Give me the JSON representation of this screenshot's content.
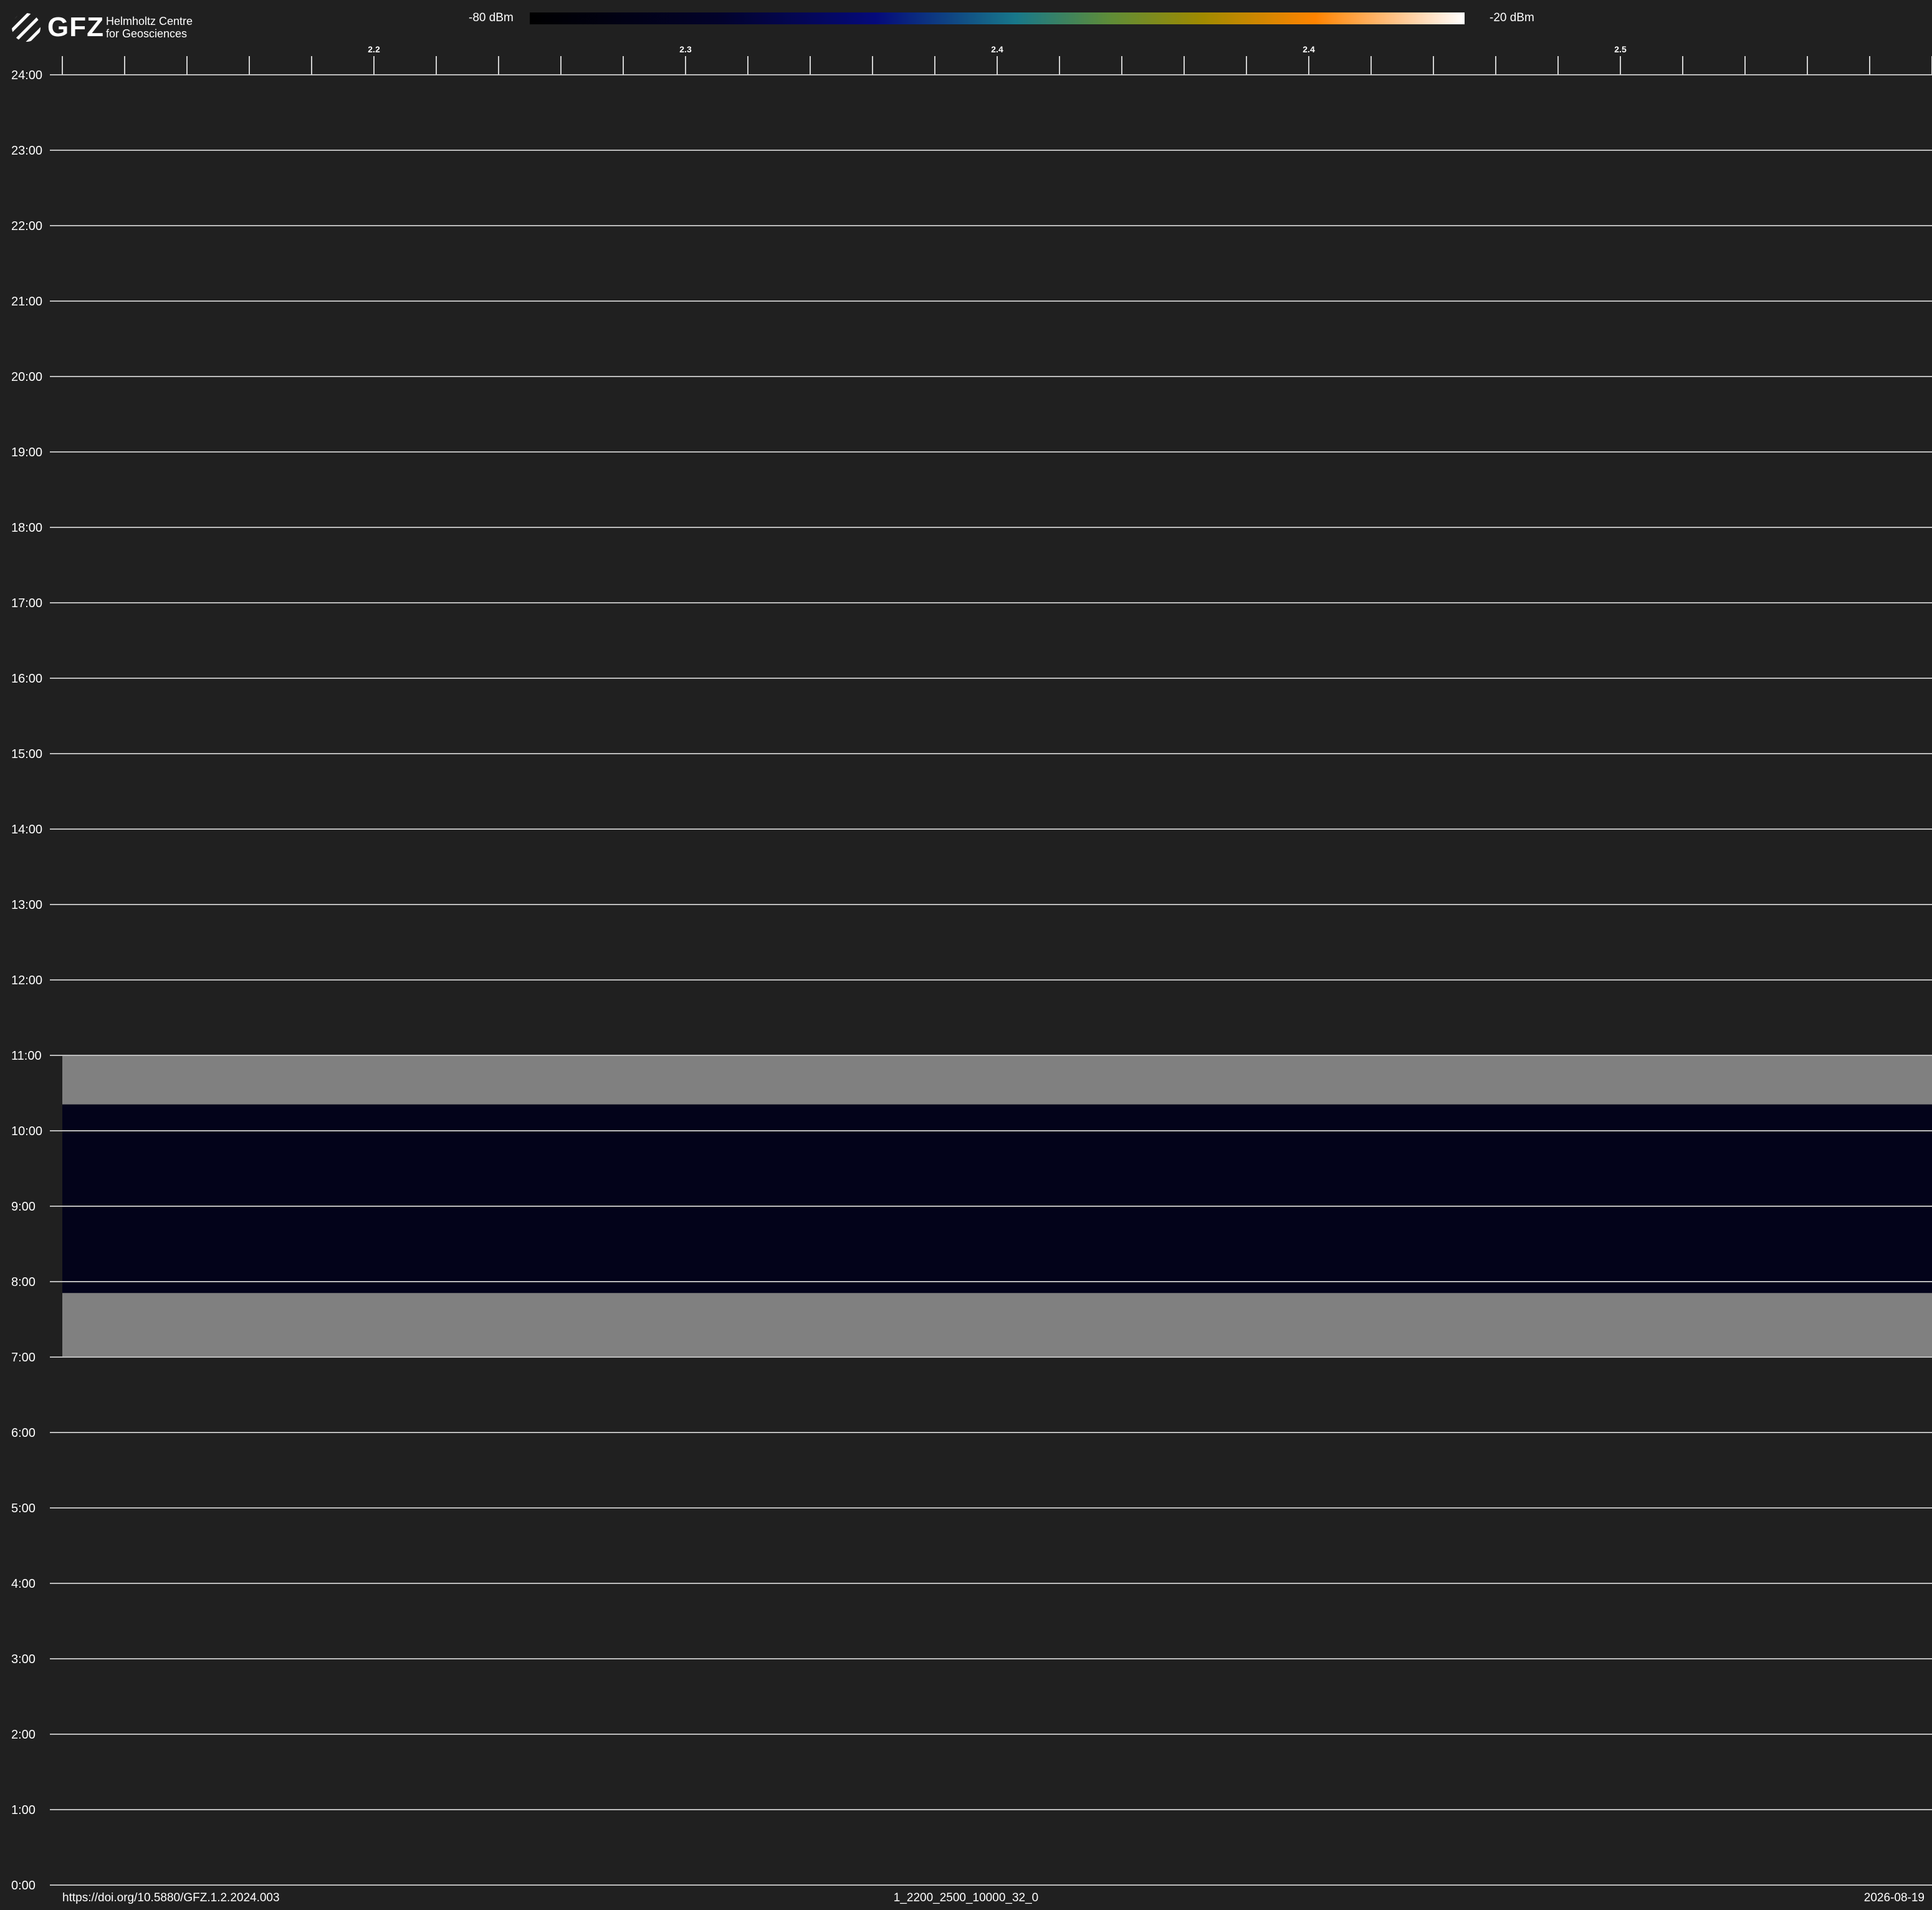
{
  "header": {
    "logo_word": "GFZ",
    "logo_line1": "Helmholtz Centre",
    "logo_line2": "for Geosciences"
  },
  "colorbar": {
    "min_label": "-80 dBm",
    "max_label": "-20 dBm",
    "min_value": -80,
    "max_value": -20,
    "colors": [
      "#000000",
      "#02022a",
      "#050a7a",
      "#18788a",
      "#5e8c38",
      "#a08a00",
      "#ff8300",
      "#ffc68e",
      "#ffffff"
    ]
  },
  "footer": {
    "doi": "https://doi.org/10.5880/GFZ.1.2.2024.003",
    "id": "1_2200_2500_10000_32_0",
    "date": "2026-08-19"
  },
  "chart_data": {
    "type": "heatmap",
    "y_ticks": [
      "0:00",
      "1:00",
      "2:00",
      "3:00",
      "4:00",
      "5:00",
      "6:00",
      "7:00",
      "8:00",
      "9:00",
      "10:00",
      "11:00",
      "12:00",
      "13:00",
      "14:00",
      "15:00",
      "16:00",
      "17:00",
      "18:00",
      "19:00",
      "20:00",
      "21:00",
      "22:00",
      "23:00",
      "24:00"
    ],
    "ylim": [
      0,
      24
    ],
    "x_tick_labels": [
      "2.2",
      "2.3",
      "2.4",
      "2.4",
      "2.5"
    ],
    "x_tick_label_every": 5,
    "x_minor_tick_count": 31,
    "grid": true,
    "bands": [
      {
        "kind": "no-data",
        "y_start": 7.0,
        "y_end": 7.85,
        "color": "#808080"
      },
      {
        "kind": "signal",
        "y_start": 7.85,
        "y_end": 10.35,
        "color": "#03031a"
      },
      {
        "kind": "no-data",
        "y_start": 10.35,
        "y_end": 11.0,
        "color": "#808080"
      }
    ]
  }
}
